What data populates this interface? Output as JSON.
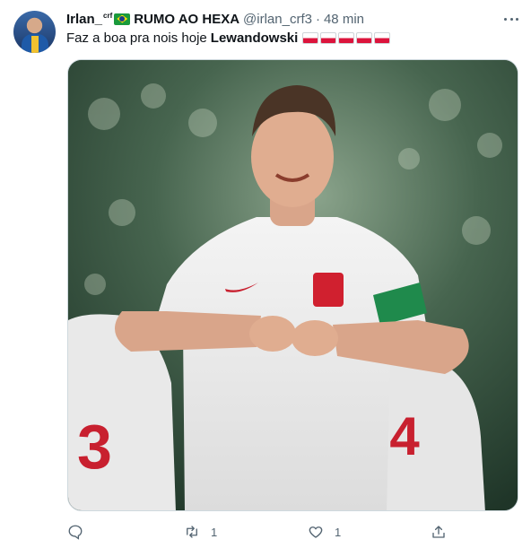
{
  "tweet": {
    "author_name": "Irlan_",
    "author_sup": "crf",
    "author_badge": "RUMO AO HEXA",
    "handle": "@irlan_crf3",
    "separator": "·",
    "time": "48 min",
    "text_prefix": "Faz a boa pra nois hoje",
    "text_bold": "Lewandowski",
    "flags_count": 5
  },
  "actions": {
    "reply_count": "",
    "retweet_count": "1",
    "like_count": "1"
  },
  "colors": {
    "text_primary": "#0f1419",
    "text_secondary": "#536471",
    "media_border": "#cfd9de"
  },
  "icons": [
    "more-icon",
    "reply-icon",
    "retweet-icon",
    "like-icon",
    "share-icon"
  ]
}
